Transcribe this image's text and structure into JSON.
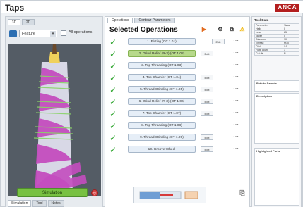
{
  "app": {
    "title": "Taps",
    "brand": "ANCA"
  },
  "left_panel": {
    "top_tabs": [
      "3D",
      "2D"
    ],
    "tool_selector": {
      "value": "Feature"
    },
    "all_operations_label": "All operations",
    "run_button": "Simulation",
    "bottom_tabs": [
      "Simulation",
      "Tool",
      "Notes"
    ]
  },
  "main": {
    "tabs": [
      "Operations",
      "Contour Parameters"
    ],
    "section_title": "Selected Operations",
    "operations": [
      {
        "label": "1. Fluting (OT 1.01)",
        "small": ""
      },
      {
        "label": "2. Grind Relief (R-3) (OT 1.02)",
        "small": "Edit"
      },
      {
        "label": "3. Top Threading (OT 1.03)",
        "small": ""
      },
      {
        "label": "4. Top Chamfer (OT 1.04)",
        "small": "Edit"
      },
      {
        "label": "5. Thread Grinding (OT 1.05)",
        "small": "Edit"
      },
      {
        "label": "6. Grind Relief (R-3) (OT 1.06)",
        "small": "Edit"
      },
      {
        "label": "7. Top Chamfer (OT 1.07)",
        "small": "Edit"
      },
      {
        "label": "8. Top Threading (OT 1.08)",
        "small": ""
      },
      {
        "label": "9. Thread Grinding (OT 1.09)",
        "small": "Edit"
      },
      {
        "label": "10. Groove Wheel",
        "small": "Edit"
      }
    ],
    "right_small_button_first": "Edit"
  },
  "right_panel": {
    "tool_data_title": "Tool Data",
    "param_headers": [
      "Parameter",
      "Value"
    ],
    "params": [
      [
        "Helix",
        "0"
      ],
      [
        "Lead",
        "85"
      ],
      [
        "Taper",
        "0"
      ],
      [
        "Diameter",
        "10"
      ],
      [
        "Thread",
        "M10"
      ],
      [
        "Pitch",
        "1.5"
      ],
      [
        "Flute count",
        "3"
      ],
      [
        "Cut dir",
        "R"
      ]
    ],
    "box1_label": "Path to Sample",
    "box2_label": "Description",
    "box3_label": "Highlighted Parts"
  },
  "colors": {
    "accent": "#78c142",
    "brand": "#b31e1e",
    "tap_pink": "#c44dbf"
  }
}
